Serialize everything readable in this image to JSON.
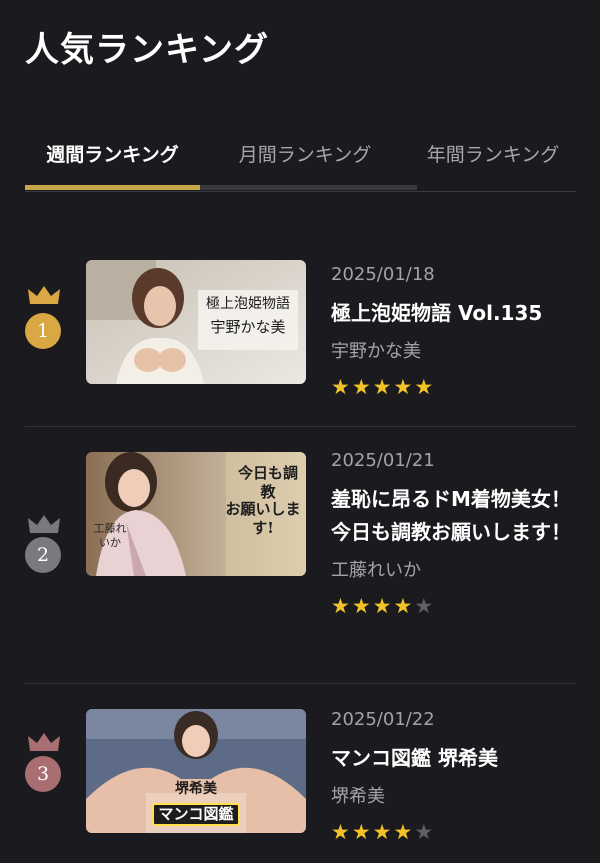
{
  "page": {
    "title": "人気ランキング"
  },
  "tabs": [
    {
      "label": "週間ランキング",
      "active": true
    },
    {
      "label": "月間ランキング",
      "active": false
    },
    {
      "label": "年間ランキング",
      "active": false
    }
  ],
  "colors": {
    "accent": "#c6a84a",
    "gold": "#d9a743",
    "silver": "#7a7a7e",
    "bronze": "#a86e72",
    "star": "#f2c227"
  },
  "rankings": [
    {
      "rank": "1",
      "date": "2025/01/18",
      "title": "極上泡姫物語 Vol.135",
      "actress": "宇野かな美",
      "rating": 5,
      "thumb_text": [
        "極上泡姫物語",
        "宇野かな美"
      ]
    },
    {
      "rank": "2",
      "date": "2025/01/21",
      "title": "羞恥に昂るドM着物美女！今日も調教お願いします！",
      "actress": "工藤れいか",
      "rating": 4,
      "thumb_text": [
        "今日も調教",
        "お願いします!",
        "工藤れいか"
      ]
    },
    {
      "rank": "3",
      "date": "2025/01/22",
      "title": "マンコ図鑑 堺希美",
      "actress": "堺希美",
      "rating": 4,
      "thumb_text": [
        "堺希美",
        "マンコ図鑑"
      ]
    }
  ]
}
